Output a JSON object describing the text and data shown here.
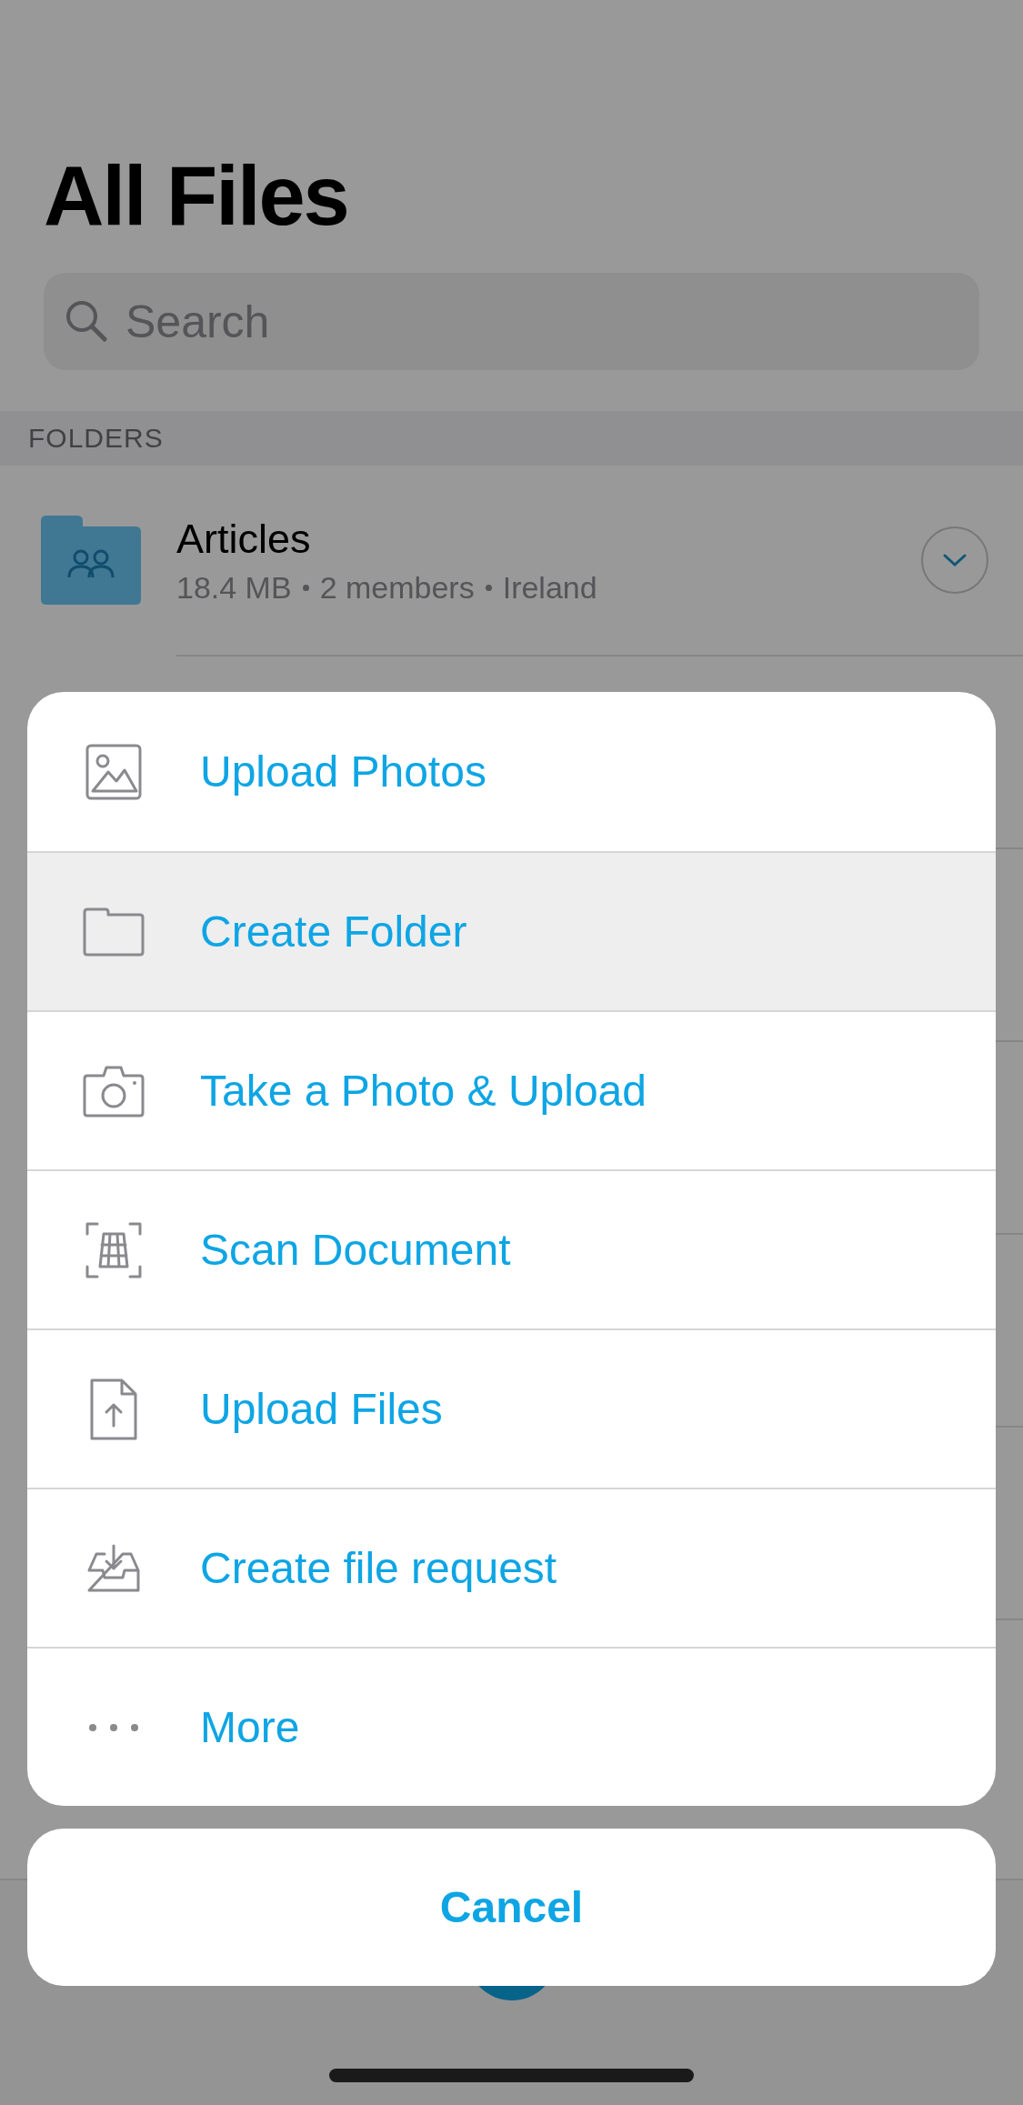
{
  "title": "All Files",
  "search": {
    "placeholder": "Search"
  },
  "section_header": "FOLDERS",
  "folders": [
    {
      "name": "Articles",
      "details": [
        "18.4 MB",
        "2 members",
        "Ireland"
      ]
    }
  ],
  "action_sheet": {
    "items": [
      {
        "kind": "photo",
        "label": "Upload Photos",
        "selected": false
      },
      {
        "kind": "folder",
        "label": "Create Folder",
        "selected": true
      },
      {
        "kind": "camera",
        "label": "Take a Photo & Upload",
        "selected": false
      },
      {
        "kind": "scan",
        "label": "Scan Document",
        "selected": false
      },
      {
        "kind": "file",
        "label": "Upload Files",
        "selected": false
      },
      {
        "kind": "inbox",
        "label": "Create file request",
        "selected": false
      },
      {
        "kind": "more",
        "label": "More",
        "selected": false
      }
    ],
    "cancel": "Cancel"
  }
}
